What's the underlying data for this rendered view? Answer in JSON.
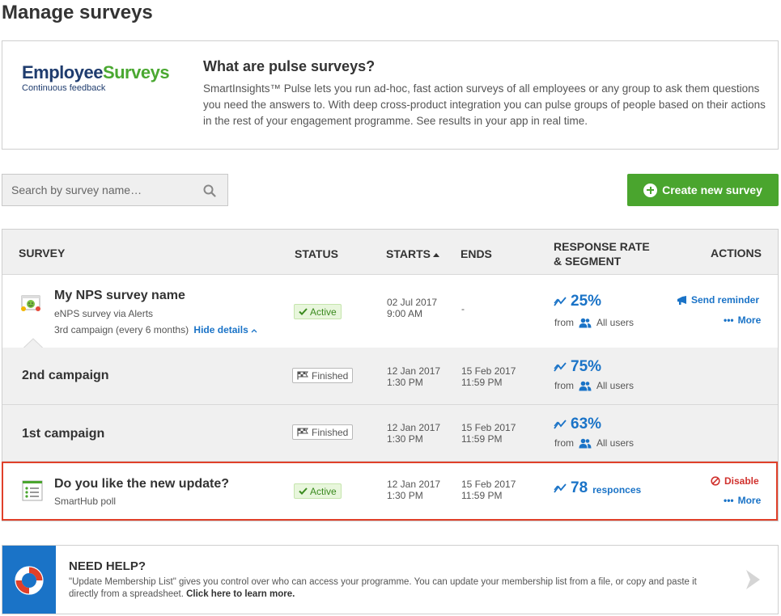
{
  "page": {
    "title": "Manage surveys"
  },
  "info": {
    "logo_main_a": "Employee",
    "logo_main_b": "Surveys",
    "logo_sub": "Continuous feedback",
    "title": "What are pulse surveys?",
    "text": "SmartInsights™ Pulse lets you run ad-hoc, fast action surveys of all employees or any group to ask them questions you need the answers to. With deep cross-product integration you can pulse groups of people based on their actions in the rest of your engagement programme. See results in your app in real time."
  },
  "search": {
    "placeholder": "Search by survey name…",
    "icon": "search-icon"
  },
  "create_button": {
    "label": "Create new survey",
    "icon": "plus-circle-icon"
  },
  "table": {
    "headers": {
      "survey": "SURVEY",
      "status": "STATUS",
      "starts": "STARTS",
      "ends": "ENDS",
      "response_1": "RESPONSE RATE",
      "response_2": "& SEGMENT",
      "actions": "ACTIONS"
    },
    "rows": [
      {
        "name": "My NPS survey name",
        "sub1": "eNPS survey via Alerts",
        "sub2": "3rd campaign (every 6 months)",
        "toggle": "Hide details",
        "status": "Active",
        "start_date": "02 Jul 2017",
        "start_time": "9:00 AM",
        "end": "-",
        "rate": "25%",
        "from": "from",
        "segment": "All users",
        "action1": "Send reminder",
        "action2": "More"
      },
      {
        "name": "2nd campaign",
        "status": "Finished",
        "start_date": "12 Jan 2017",
        "start_time": "1:30 PM",
        "end_date": "15 Feb 2017",
        "end_time": "11:59 PM",
        "rate": "75%",
        "from": "from",
        "segment": "All users"
      },
      {
        "name": "1st campaign",
        "status": "Finished",
        "start_date": "12 Jan 2017",
        "start_time": "1:30 PM",
        "end_date": "15 Feb 2017",
        "end_time": "11:59 PM",
        "rate": "63%",
        "from": "from",
        "segment": "All users"
      },
      {
        "name": "Do you like the new update?",
        "sub1": "SmartHub poll",
        "status": "Active",
        "start_date": "12 Jan 2017",
        "start_time": "1:30 PM",
        "end_date": "15 Feb 2017",
        "end_time": "11:59 PM",
        "rate": "78",
        "rate_suffix": "responces",
        "action1": "Disable",
        "action2": "More"
      }
    ]
  },
  "help": {
    "title": "NEED HELP?",
    "text": "\"Update Membership List\" gives you control over who can access your programme. You can update your membership list from a file, or copy and paste it directly from a spreadsheet.",
    "link": "Click here to learn more."
  },
  "colors": {
    "accent_blue": "#1a73c7",
    "brand_green": "#4aa52e",
    "highlight_red": "#e0402a"
  }
}
